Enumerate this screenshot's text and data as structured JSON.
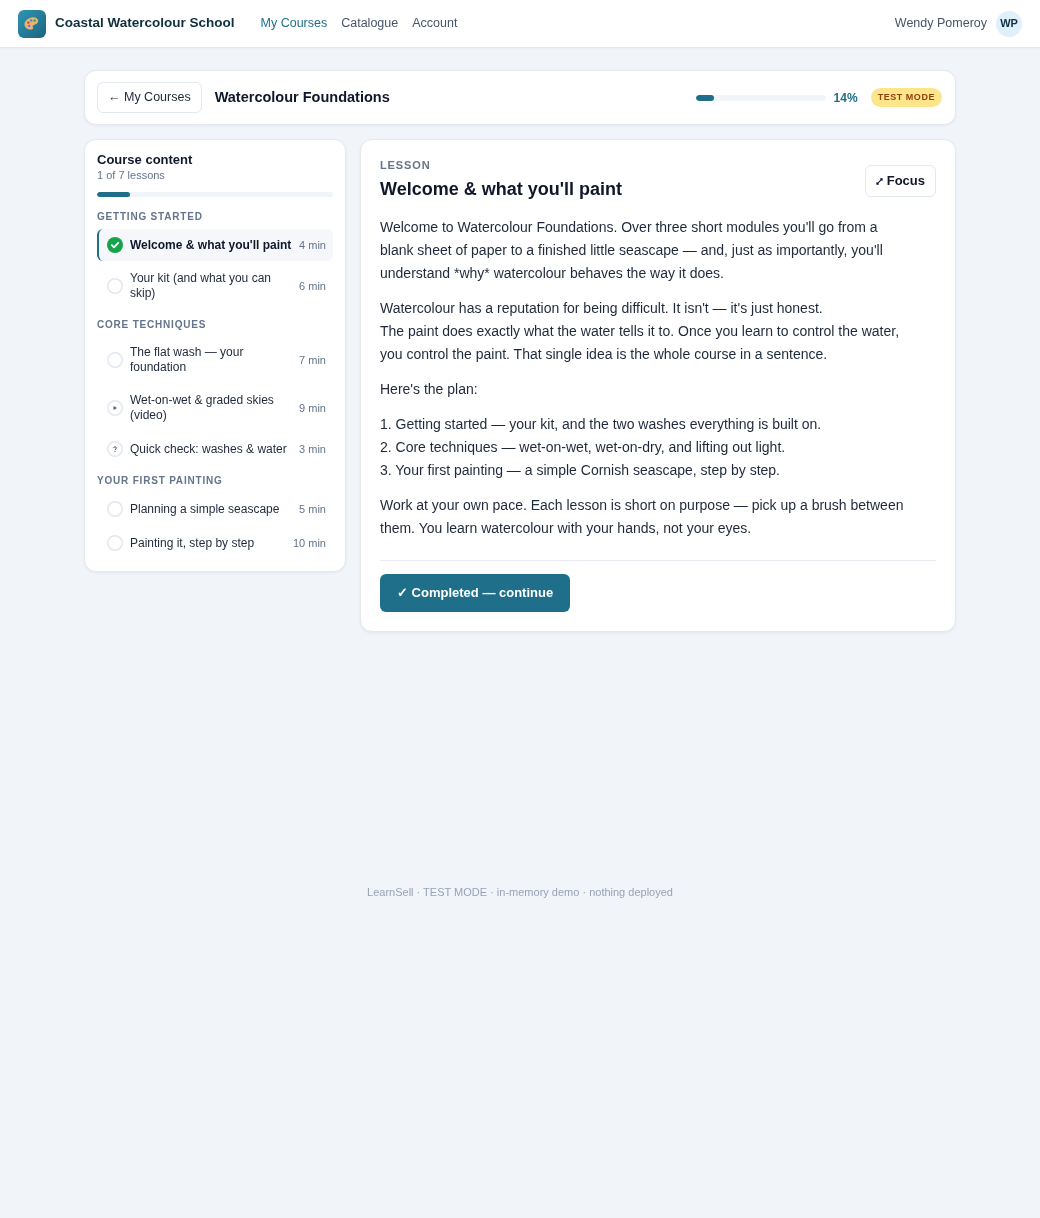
{
  "header": {
    "brand": "Coastal Watercolour School",
    "nav": [
      {
        "label": "My Courses",
        "selected": true
      },
      {
        "label": "Catalogue",
        "selected": false
      },
      {
        "label": "Account",
        "selected": false
      }
    ],
    "user": {
      "name": "Wendy Pomeroy",
      "initials": "WP"
    }
  },
  "course_bar": {
    "back_button": "← My Courses",
    "title": "Watercolour Foundations",
    "progress": {
      "level": 0.14,
      "reading": "14%"
    },
    "badge": "TEST MODE"
  },
  "sidebar": {
    "title": "Course content",
    "subtitle": "1 of 7 lessons",
    "progress": {
      "level": 0.14
    },
    "sections": [
      {
        "heading": "GETTING STARTED",
        "lessons": [
          {
            "title": "Welcome & what you'll paint",
            "duration": "4 min",
            "completed": true,
            "selected": true
          },
          {
            "title": "Your kit (and what you can skip)",
            "duration": "6 min",
            "kind": "text",
            "completed": false,
            "selected": false
          }
        ]
      },
      {
        "heading": "CORE TECHNIQUES",
        "lessons": [
          {
            "title": "The flat wash — your foundation",
            "duration": "7 min",
            "kind": "text",
            "completed": false,
            "selected": false
          },
          {
            "title": "Wet-on-wet & graded skies (video)",
            "duration": "9 min",
            "kind": "video",
            "completed": false,
            "selected": false
          },
          {
            "title": "Quick check: washes & water",
            "duration": "3 min",
            "kind": "quiz",
            "completed": false,
            "selected": false
          }
        ]
      },
      {
        "heading": "YOUR FIRST PAINTING",
        "lessons": [
          {
            "title": "Planning a simple seascape",
            "duration": "5 min",
            "kind": "text",
            "completed": false,
            "selected": false
          },
          {
            "title": "Painting it, step by step",
            "duration": "10 min",
            "kind": "text",
            "completed": false,
            "selected": false
          }
        ]
      }
    ]
  },
  "lesson": {
    "eyebrow": "LESSON",
    "title": "Welcome & what you'll paint",
    "focus_button": "Focus",
    "body": [
      {
        "kind": "paragraph",
        "text": "Welcome to Watercolour Foundations. Over three short modules you'll go from a blank sheet of paper to a finished little seascape — and, just as importantly, you'll understand *why* watercolour behaves the way it does."
      },
      {
        "kind": "paragraph",
        "text": "Watercolour has a reputation for being difficult. It isn't — it's just honest.\nThe paint does exactly what the water tells it to. Once you learn to control the water, you control the paint. That single idea is the whole course in a sentence."
      },
      {
        "kind": "paragraph",
        "text": "Here's the plan:"
      },
      {
        "kind": "list",
        "items": [
          "1. Getting started — your kit, and the two washes everything is built on.",
          "2. Core techniques — wet-on-wet, wet-on-dry, and lifting out light.",
          "3. Your first painting — a simple Cornish seascape, step by step."
        ]
      },
      {
        "kind": "paragraph",
        "text": "Work at your own pace. Each lesson is short on purpose — pick up a brush between them. You learn watercolour with your hands, not your eyes."
      }
    ],
    "complete_button": "✓ Completed — continue"
  },
  "footer": "LearnSell · TEST MODE · in-memory demo · nothing deployed"
}
